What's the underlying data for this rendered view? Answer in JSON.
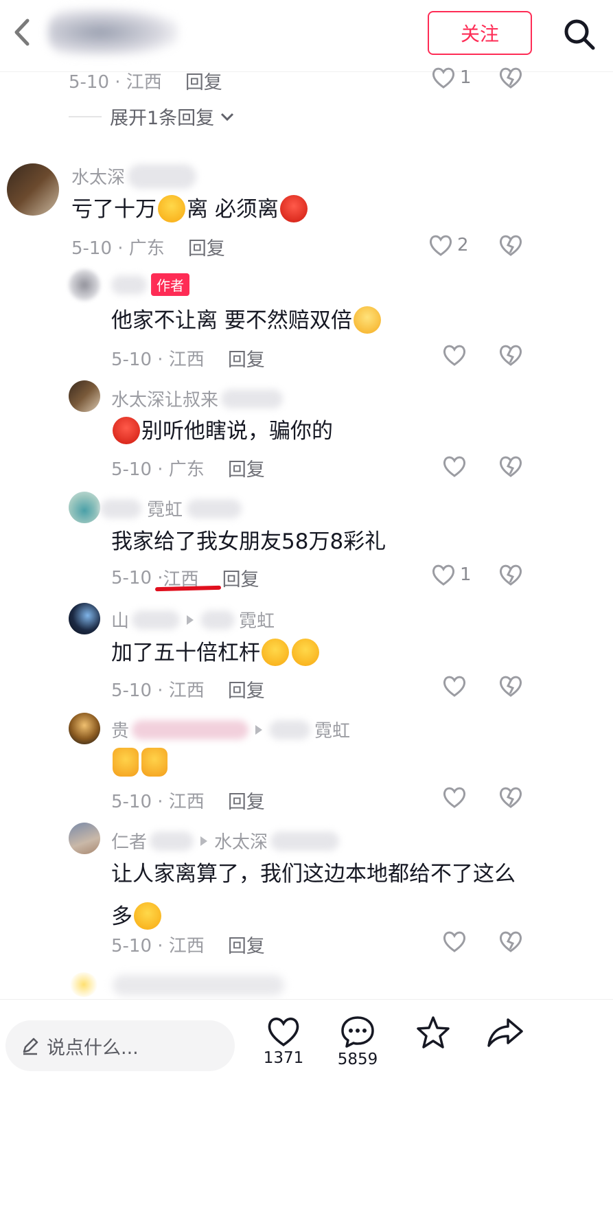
{
  "header": {
    "follow_label": "关注"
  },
  "top_meta": {
    "date_loc": "5-10 · 江西",
    "reply": "回复",
    "likes": "1"
  },
  "expand_label": "展开1条回复",
  "comments": [
    {
      "name": "水太深",
      "text_a": "亏了十万",
      "text_b": "离  必须离",
      "date_loc": "5-10 · 广东",
      "reply": "回复",
      "likes": "2"
    },
    {
      "badge": "作者",
      "text": "他家不让离 要不然赔双倍",
      "date_loc": "5-10 · 江西",
      "reply": "回复"
    },
    {
      "name": "水太深让叔来",
      "text": "别听他瞎说，骗你的",
      "date_loc": "5-10 · 广东",
      "reply": "回复"
    },
    {
      "name": "霓虹",
      "text": "我家给了我女朋友58万8彩礼",
      "date_loc_date": "5-10 · ",
      "date_loc_place": "江西",
      "reply": "回复",
      "likes": "1"
    },
    {
      "name_start": "山",
      "target": "霓虹",
      "text": "加了五十倍杠杆",
      "date_loc": "5-10 · 江西",
      "reply": "回复"
    },
    {
      "name_start": "贵",
      "target": "霓虹",
      "text": "",
      "date_loc": "5-10 · 江西",
      "reply": "回复"
    },
    {
      "name_start": "仁者",
      "target": "水太深",
      "text_line1": "让人家离算了，我们这边本地都给不了这么",
      "text_line2": "多",
      "date_loc": "5-10 · 江西",
      "reply": "回复"
    }
  ],
  "bottom": {
    "placeholder": "说点什么...",
    "likes_count": "1371",
    "comments_count": "5859"
  },
  "icons": [
    "back-arrow-icon",
    "search-icon",
    "heart-icon",
    "broken-heart-icon",
    "chevron-down-icon",
    "pen-icon",
    "comment-icon",
    "star-icon",
    "share-icon"
  ],
  "colors": {
    "accent": "#fe2c55",
    "annotation_underline": "#e0101e",
    "meta_text": "#9b9ca2"
  }
}
